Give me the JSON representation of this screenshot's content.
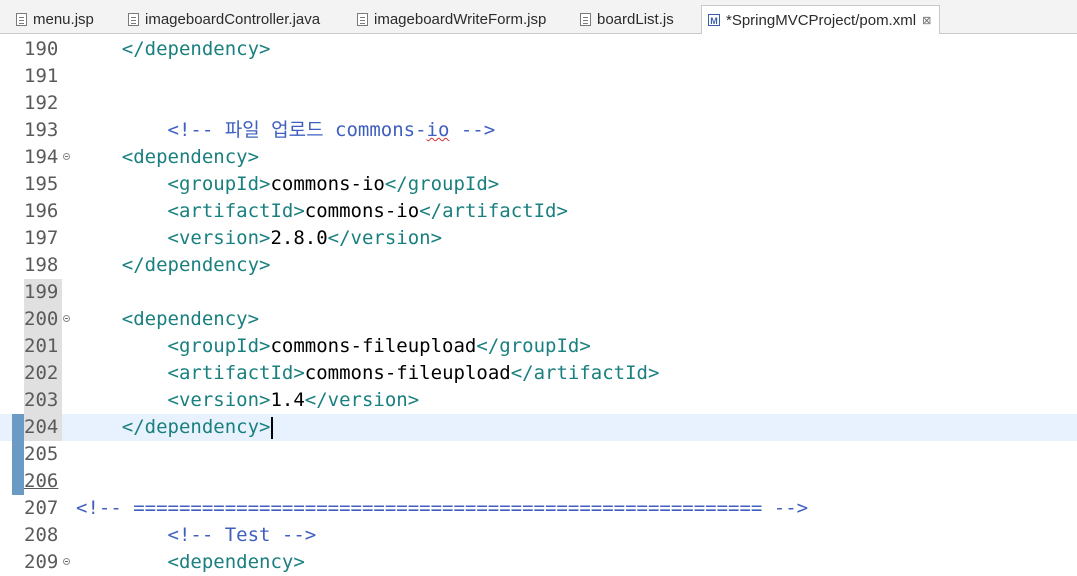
{
  "tabs": [
    {
      "label": "menu.jsp",
      "icon": "jsp-file-icon"
    },
    {
      "label": "imageboardController.java",
      "icon": "java-file-icon"
    },
    {
      "label": "imageboardWriteForm.jsp",
      "icon": "jsp-file-icon"
    },
    {
      "label": "boardList.js",
      "icon": "js-file-icon"
    },
    {
      "label": "*SpringMVCProject/pom.xml",
      "icon": "maven-pom-icon",
      "active": true,
      "close": "⊠"
    }
  ],
  "lines": [
    {
      "n": "190",
      "parts": [
        [
          "    ",
          "txt"
        ],
        [
          "</dependency>",
          "tag"
        ]
      ]
    },
    {
      "n": "191",
      "parts": []
    },
    {
      "n": "192",
      "parts": []
    },
    {
      "n": "193",
      "parts": [
        [
          "        ",
          "txt"
        ],
        [
          "<!-- 파일 업로드 ",
          "cmt"
        ],
        [
          "commons-",
          "cmt"
        ],
        [
          "io",
          "cmt-sq"
        ],
        [
          " -->",
          "cmt"
        ]
      ]
    },
    {
      "n": "194",
      "fold": true,
      "parts": [
        [
          "    ",
          "txt"
        ],
        [
          "<dependency>",
          "tag"
        ]
      ]
    },
    {
      "n": "195",
      "parts": [
        [
          "        ",
          "txt"
        ],
        [
          "<groupId>",
          "tag"
        ],
        [
          "commons-io",
          "txt"
        ],
        [
          "</groupId>",
          "tag"
        ]
      ]
    },
    {
      "n": "196",
      "parts": [
        [
          "        ",
          "txt"
        ],
        [
          "<artifactId>",
          "tag"
        ],
        [
          "commons-io",
          "txt"
        ],
        [
          "</artifactId>",
          "tag"
        ]
      ]
    },
    {
      "n": "197",
      "parts": [
        [
          "        ",
          "txt"
        ],
        [
          "<version>",
          "tag"
        ],
        [
          "2.8.0",
          "txt"
        ],
        [
          "</version>",
          "tag"
        ]
      ]
    },
    {
      "n": "198",
      "parts": [
        [
          "    ",
          "txt"
        ],
        [
          "</dependency>",
          "tag"
        ]
      ]
    },
    {
      "n": "199",
      "hl": true,
      "parts": []
    },
    {
      "n": "200",
      "hl": true,
      "fold": true,
      "parts": [
        [
          "    ",
          "txt"
        ],
        [
          "<dependency>",
          "tag"
        ]
      ]
    },
    {
      "n": "201",
      "hl": true,
      "parts": [
        [
          "        ",
          "txt"
        ],
        [
          "<groupId>",
          "tag"
        ],
        [
          "commons-fileupload",
          "txt"
        ],
        [
          "</groupId>",
          "tag"
        ]
      ]
    },
    {
      "n": "202",
      "hl": true,
      "parts": [
        [
          "        ",
          "txt"
        ],
        [
          "<artifactId>",
          "tag"
        ],
        [
          "commons-fileupload",
          "txt"
        ],
        [
          "</artifactId>",
          "tag"
        ]
      ]
    },
    {
      "n": "203",
      "hl": true,
      "parts": [
        [
          "        ",
          "txt"
        ],
        [
          "<version>",
          "tag"
        ],
        [
          "1.4",
          "txt"
        ],
        [
          "</version>",
          "tag"
        ]
      ]
    },
    {
      "n": "204",
      "hl": true,
      "cur": true,
      "chg": true,
      "parts": [
        [
          "    ",
          "txt"
        ],
        [
          "</dependency>",
          "tag"
        ]
      ]
    },
    {
      "n": "205",
      "chg": true,
      "parts": []
    },
    {
      "n": "206",
      "chg": true,
      "under": true,
      "parts": []
    },
    {
      "n": "207",
      "parts": [
        [
          "<!-- ======================================================= -->",
          "cmt"
        ]
      ]
    },
    {
      "n": "208",
      "parts": [
        [
          "        ",
          "txt"
        ],
        [
          "<!-- Test -->",
          "cmt"
        ]
      ]
    },
    {
      "n": "209",
      "fold": true,
      "parts": [
        [
          "        ",
          "txt"
        ],
        [
          "<dependency>",
          "tag"
        ]
      ]
    }
  ]
}
